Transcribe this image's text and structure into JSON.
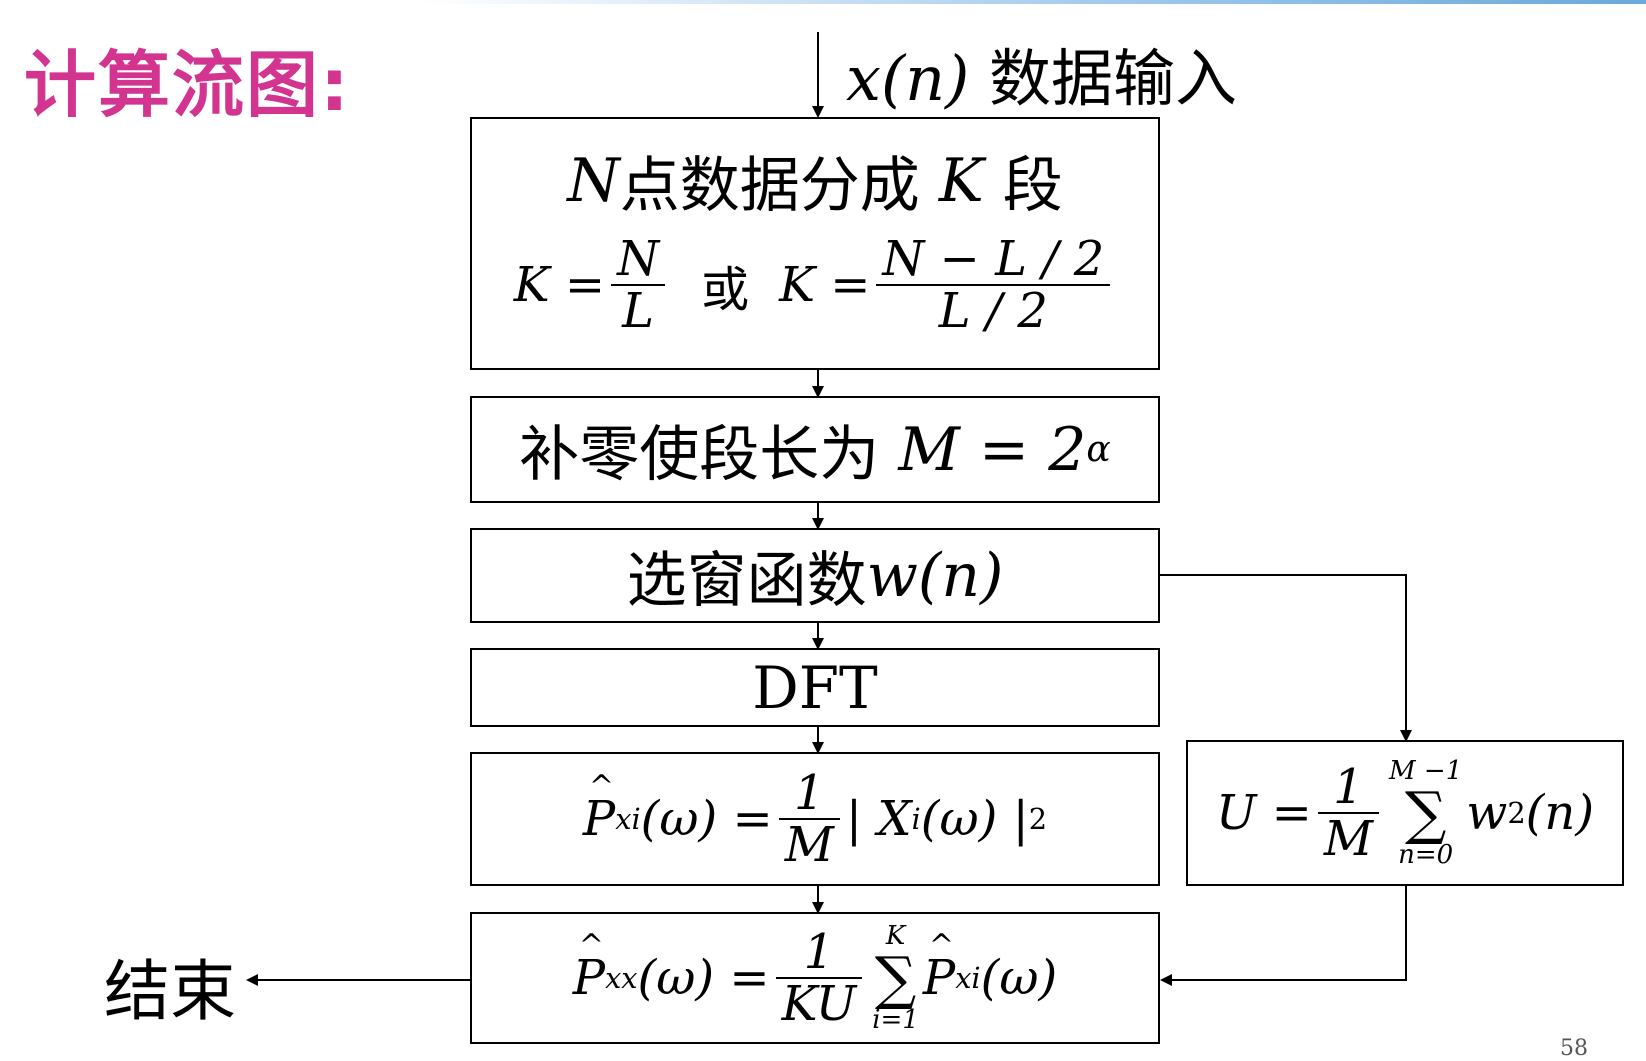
{
  "title": "计算流图:",
  "input": {
    "var": "x(n)",
    "text": "数据输入"
  },
  "box1": {
    "line1_var_n": "N",
    "line1_text_a": "点数据分成",
    "line1_var_k": "K",
    "line1_text_b": "段",
    "f1_lhs": "K =",
    "f1_num": "N",
    "f1_den": "L",
    "or": "或",
    "f2_lhs": "K =",
    "f2_num": "N − L / 2",
    "f2_den": "L / 2"
  },
  "box2": {
    "text": "补零使段长为",
    "formula": "M = 2",
    "exp": "α"
  },
  "box3": {
    "text": "选窗函数",
    "formula": "w(n)"
  },
  "box4": {
    "text": "DFT"
  },
  "box5": {
    "lhs_p": "P",
    "lhs_sub": "xi",
    "lhs_rest": "(ω) =",
    "num": "1",
    "den": "M",
    "rhs": "| X",
    "rhs_sub": "i",
    "rhs_rest": "(ω) |",
    "rhs_sup": "2"
  },
  "box6": {
    "lhs": "U =",
    "num": "1",
    "den": "M",
    "sum_top": "M −1",
    "sum_bot": "n=0",
    "term": "w",
    "term_sup": "2",
    "term_rest": "(n)"
  },
  "box7": {
    "lhs_p": "P",
    "lhs_sub": "xx",
    "lhs_rest": "(ω) =",
    "num": "1",
    "den": "KU",
    "sum_top": "K",
    "sum_bot": "i=1",
    "term_p": "P",
    "term_sub": "xi",
    "term_rest": "(ω)"
  },
  "end": "结束",
  "page_number": "58"
}
